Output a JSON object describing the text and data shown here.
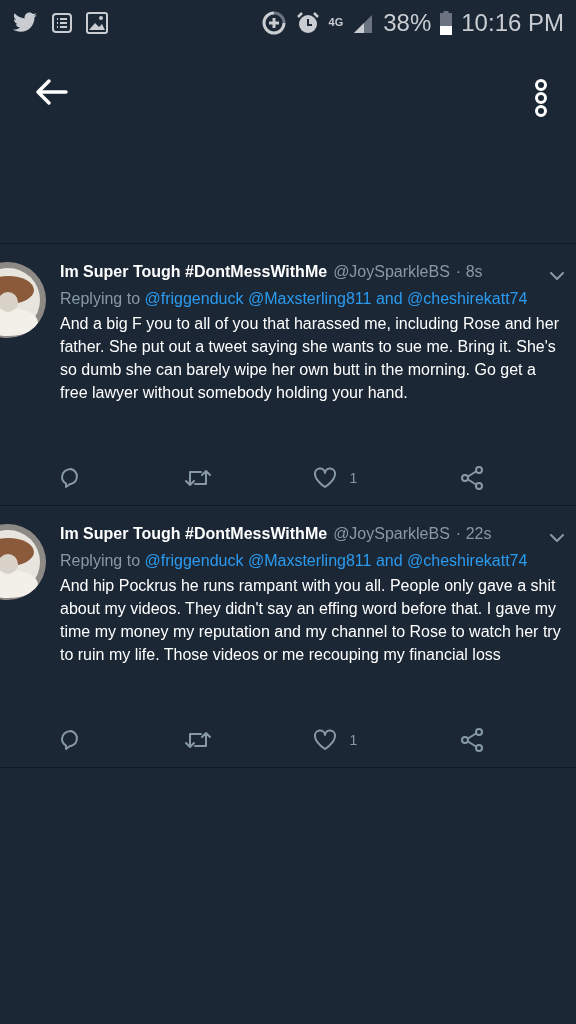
{
  "status_bar": {
    "network": "4G",
    "battery": "38%",
    "time": "10:16 PM"
  },
  "tweets": [
    {
      "name": "Im Super Tough #DontMessWithMe",
      "handle": "@JoySparkleBS",
      "time": "· 8s",
      "reply_prefix": "Replying to",
      "reply_links": [
        "@friggenduck",
        "@Maxsterling811 and",
        "@cheshirekatt74"
      ],
      "text": "And a big F you to all of you that harassed me, including Rose and her father. She put out a tweet saying she wants to sue me. Bring it. She's so dumb she can barely wipe her own butt in the morning. Go get a free lawyer without somebody holding your hand.",
      "likes": "1"
    },
    {
      "name": "Im Super Tough #DontMessWithMe",
      "handle": "@JoySparkleBS",
      "time": "· 22s",
      "reply_prefix": "Replying to",
      "reply_links": [
        "@friggenduck",
        "@Maxsterling811 and",
        "@cheshirekatt74"
      ],
      "text": "And hip Pockrus he runs rampant with you all. People only gave a shit about my videos. They didn't say an effing word before that. I gave my time my money my reputation and my channel to Rose to watch her try to ruin my life. Those videos or me recouping my financial loss",
      "likes": "1"
    }
  ]
}
